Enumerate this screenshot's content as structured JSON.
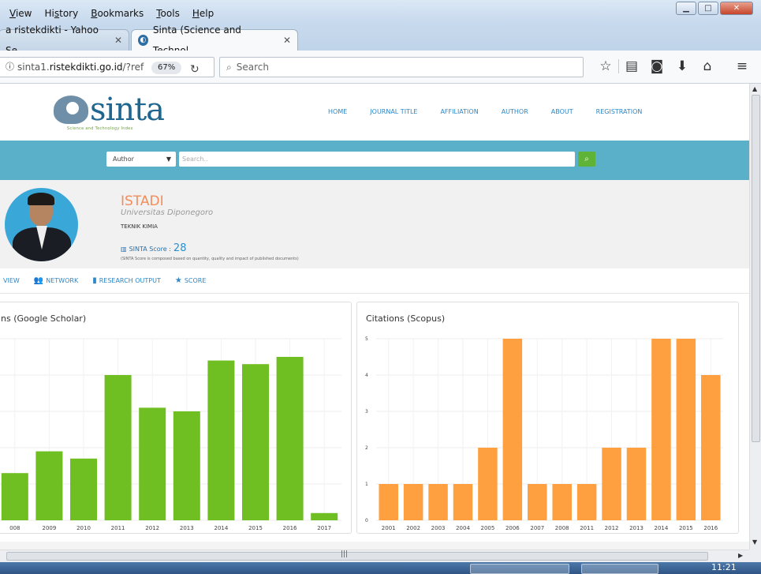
{
  "menu": {
    "items": [
      "View",
      "History",
      "Bookmarks",
      "Tools",
      "Help"
    ],
    "underline": [
      "V",
      "s",
      "B",
      "T",
      "H"
    ]
  },
  "tabs": [
    {
      "label": "a ristekdikti - Yahoo Se...",
      "active": false
    },
    {
      "label": "Sinta (Science and Technol...",
      "active": true
    }
  ],
  "address": {
    "prefix": "sinta1.",
    "domain": "ristekdikti.go.id",
    "path": "/?ref",
    "zoom": "67%"
  },
  "search_bar": {
    "placeholder": "Search"
  },
  "site": {
    "logo_text": "sinta",
    "logo_subtitle": "Science and Technology Index",
    "nav": [
      "HOME",
      "JOURNAL TITLE",
      "AFFILIATION",
      "AUTHOR",
      "ABOUT",
      "REGISTRATION"
    ],
    "search": {
      "select_value": "Author",
      "placeholder": "Search..",
      "button_icon": "search-icon"
    }
  },
  "profile": {
    "name": "ISTADI",
    "university": "Universitas Diponegoro",
    "department": "TEKNIK KIMIA",
    "score_label": "SINTA Score :",
    "score_value": "28",
    "score_note": "(SINTA Score is composed based on quantity, quality and impact of published documents)"
  },
  "subnav": [
    {
      "label": "VIEW",
      "icon": ""
    },
    {
      "label": "NETWORK",
      "icon": "users-icon"
    },
    {
      "label": "RESEARCH OUTPUT",
      "icon": "document-icon"
    },
    {
      "label": "SCORE",
      "icon": "star-icon"
    }
  ],
  "colors": {
    "green": "#6fbe22",
    "orange": "#ffa040",
    "band": "#5aafc9"
  },
  "chart_data": [
    {
      "type": "bar",
      "title": "ns (Google Scholar)",
      "categories": [
        "008",
        "2009",
        "2010",
        "2011",
        "2012",
        "2013",
        "2014",
        "2015",
        "2016",
        "2017"
      ],
      "values": [
        13,
        19,
        17,
        40,
        31,
        30,
        44,
        43,
        45,
        2
      ],
      "ylim": [
        0,
        50
      ],
      "grid": true,
      "color": "#6fbe22"
    },
    {
      "type": "bar",
      "title": "Citations (Scopus)",
      "categories": [
        "2001",
        "2002",
        "2003",
        "2004",
        "2005",
        "2006",
        "2007",
        "2008",
        "2011",
        "2012",
        "2013",
        "2014",
        "2015",
        "2016"
      ],
      "values": [
        1,
        1,
        1,
        1,
        2,
        5,
        1,
        1,
        1,
        2,
        2,
        5,
        5,
        4
      ],
      "yticks": [
        "0",
        "1",
        "2",
        "3",
        "4",
        "5"
      ],
      "ylim": [
        0,
        5
      ],
      "grid": true,
      "color": "#ffa040"
    }
  ],
  "taskbar": {
    "clock": "11:21"
  }
}
